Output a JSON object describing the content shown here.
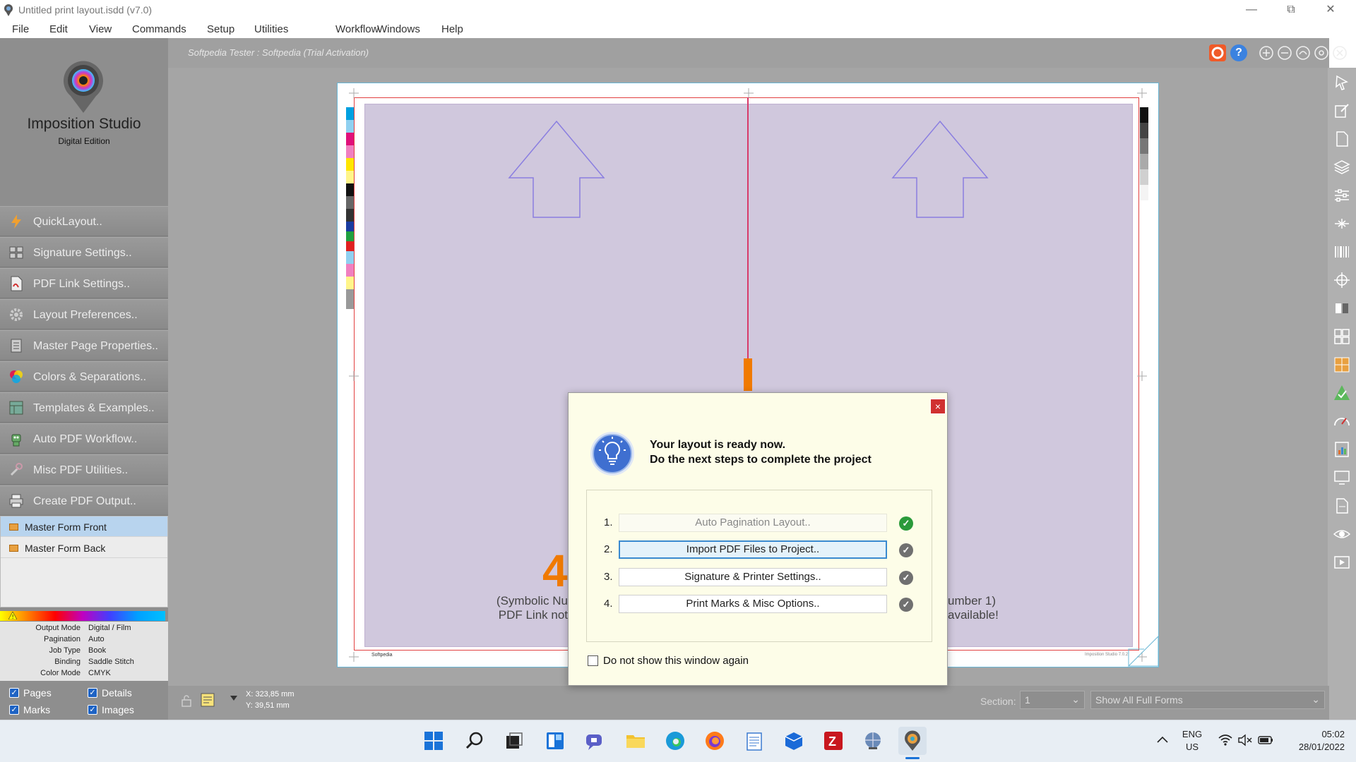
{
  "window": {
    "title": "Untitled print layout.isdd (v7.0)",
    "minimize_icon": "minimize-icon",
    "restore_icon": "restore-icon",
    "close_icon": "close-icon"
  },
  "menu": [
    "File",
    "Edit",
    "View",
    "Commands",
    "Setup",
    "Utilities",
    "Workflow",
    "Windows",
    "Help"
  ],
  "brand": {
    "name": "Imposition Studio",
    "edition": "Digital Edition"
  },
  "nav": [
    {
      "label": "QuickLayout..",
      "icon": "lightning-icon"
    },
    {
      "label": "Signature Settings..",
      "icon": "signature-icon"
    },
    {
      "label": "PDF Link Settings..",
      "icon": "pdf-link-icon"
    },
    {
      "label": "Layout Preferences..",
      "icon": "gear-icon"
    },
    {
      "label": "Master Page Properties..",
      "icon": "master-page-icon"
    },
    {
      "label": "Colors & Separations..",
      "icon": "colors-icon"
    },
    {
      "label": "Templates & Examples..",
      "icon": "templates-icon"
    },
    {
      "label": "Auto PDF Workflow..",
      "icon": "robot-icon"
    },
    {
      "label": "Misc PDF Utilities..",
      "icon": "utilities-icon"
    },
    {
      "label": "Create PDF Output..",
      "icon": "printer-icon"
    }
  ],
  "forms": [
    "Master Form Front",
    "Master Form Back"
  ],
  "info": [
    {
      "k": "Output Mode",
      "v": "Digital / Film"
    },
    {
      "k": "Pagination",
      "v": "Auto"
    },
    {
      "k": "Job Type",
      "v": "Book"
    },
    {
      "k": "Binding",
      "v": "Saddle Stitch"
    },
    {
      "k": "Color Mode",
      "v": "CMYK"
    }
  ],
  "checks": {
    "pages": "Pages",
    "details": "Details",
    "marks": "Marks",
    "images": "Images"
  },
  "workspace": {
    "license": "Softpedia Tester : Softpedia (Trial Activation)",
    "page_number": "4",
    "page_left_line1": "(Symbolic Nu",
    "page_left_line2": "PDF Link not",
    "page_right_line1": "umber 1)",
    "page_right_line2": "available!",
    "footer_left": "Softpedia",
    "footer_right": "Imposition Studio 7.0.2"
  },
  "status": {
    "x": "X: 323,85 mm",
    "y": "Y: 39,51 mm",
    "section_label": "Section:",
    "section_value": "1",
    "forms_value": "Show All Full Forms"
  },
  "dialog": {
    "headline1": "Your layout is ready now.",
    "headline2": "Do the next steps to complete the project",
    "steps": [
      {
        "n": "1.",
        "label": "Auto Pagination Layout.."
      },
      {
        "n": "2.",
        "label": "Import PDF Files to Project.."
      },
      {
        "n": "3.",
        "label": "Signature & Printer Settings.."
      },
      {
        "n": "4.",
        "label": "Print Marks & Misc Options.."
      }
    ],
    "dont_show": "Do not show this window again",
    "close_label": "×"
  },
  "tray": {
    "lang1": "ENG",
    "lang2": "US",
    "time": "05:02",
    "date": "28/01/2022"
  },
  "colors": {
    "accent": "#3a8ad0",
    "orange": "#f07a00",
    "spine": "#d83a6a",
    "trim": "#e24040"
  }
}
